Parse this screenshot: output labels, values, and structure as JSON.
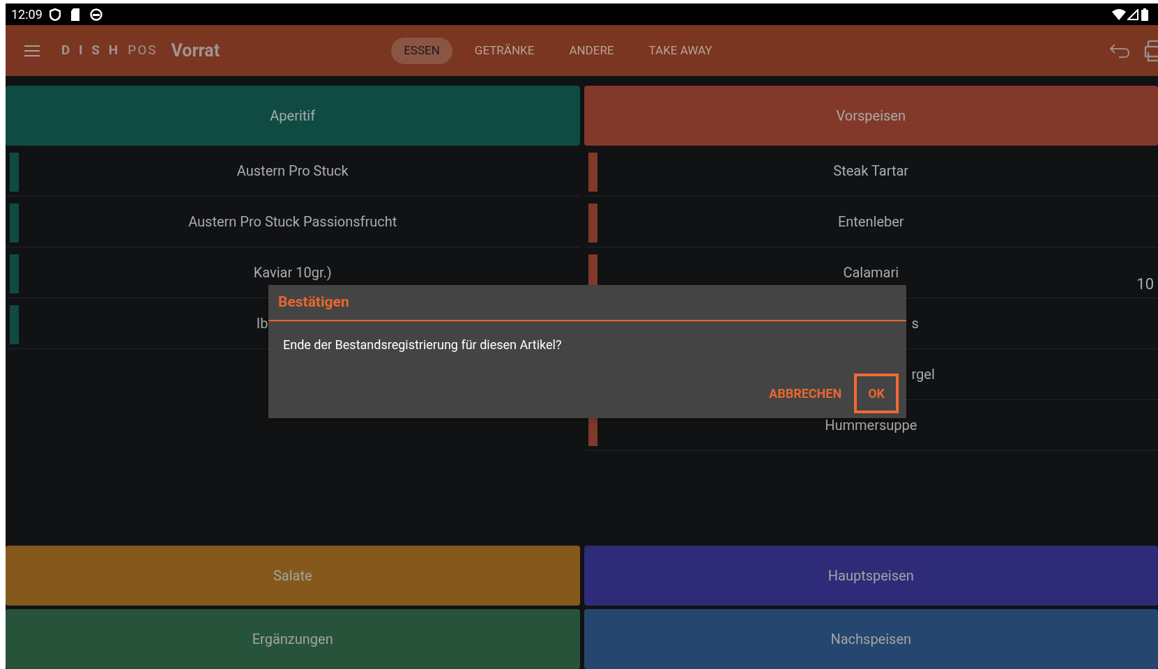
{
  "status_bar": {
    "time": "12:09"
  },
  "app_bar": {
    "logo_bold": "D I S H",
    "logo_light": "POS",
    "title": "Vorrat",
    "tabs": [
      {
        "label": "ESSEN",
        "selected": true
      },
      {
        "label": "GETRÄNKE",
        "selected": false
      },
      {
        "label": "ANDERE",
        "selected": false
      },
      {
        "label": "TAKE AWAY",
        "selected": false
      }
    ]
  },
  "columns": [
    {
      "name": "Aperitif",
      "color": "#0f4b43",
      "items": [
        {
          "label": "Austern Pro Stuck"
        },
        {
          "label": "Austern Pro Stuck Passionsfrucht"
        },
        {
          "label": "Kaviar 10gr.)"
        },
        {
          "label": "Ib",
          "kind": "clipped_end"
        }
      ]
    },
    {
      "name": "Vorspeisen",
      "color": "#83392a",
      "items": [
        {
          "label": "Steak Tartar"
        },
        {
          "label": "Entenleber"
        },
        {
          "label": "Calamari",
          "count": "10"
        },
        {
          "label": "s",
          "kind": "clipped_start"
        },
        {
          "label": "rgel",
          "kind": "clipped_start"
        },
        {
          "label": "Hummersuppe"
        }
      ]
    }
  ],
  "bottom_categories": [
    {
      "name": "Salate",
      "color": "#84591b"
    },
    {
      "name": "Hauptspeisen",
      "color": "#2e2c78"
    },
    {
      "name": "Ergänzungen",
      "color": "#28533b"
    },
    {
      "name": "Nachspeisen",
      "color": "#25476f"
    }
  ],
  "dialog": {
    "title": "Bestätigen",
    "message": "Ende der Bestandsregistrierung für diesen Artikel?",
    "buttons": [
      {
        "label": "ABBRECHEN",
        "highlighted": false
      },
      {
        "label": "OK",
        "highlighted": true
      }
    ]
  }
}
